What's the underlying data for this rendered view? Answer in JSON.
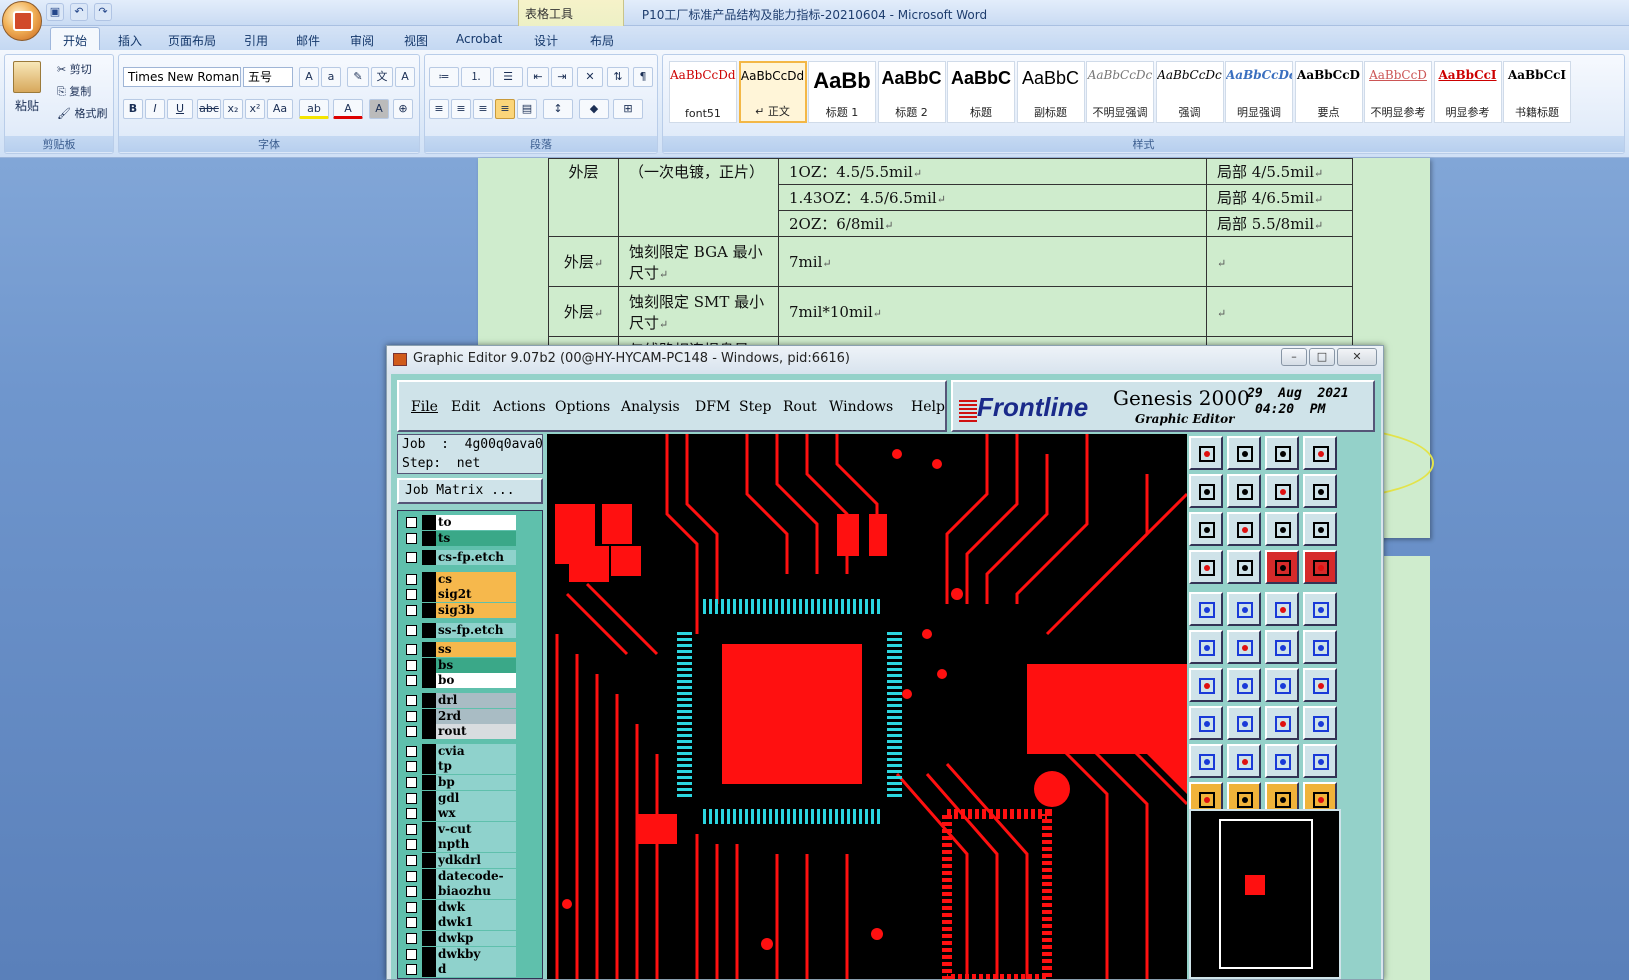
{
  "word": {
    "quick_access": [
      "save",
      "undo",
      "redo"
    ],
    "window_title": "P10工厂标准产品结构及能力指标-20210604 - Microsoft Word",
    "context_tab_group": "表格工具",
    "tabs": [
      "开始",
      "插入",
      "页面布局",
      "引用",
      "邮件",
      "审阅",
      "视图",
      "Acrobat",
      "设计",
      "布局"
    ],
    "active_tab": "开始",
    "clipboard": {
      "paste": "粘贴",
      "cut": "剪切",
      "copy": "复制",
      "format_painter": "格式刷",
      "label": "剪贴板"
    },
    "font": {
      "family": "Times New Roman",
      "size": "五号",
      "label": "字体"
    },
    "paragraph": {
      "label": "段落"
    },
    "styles": {
      "label": "样式",
      "items": [
        {
          "preview": "AaBbCcDdI",
          "name": "font51"
        },
        {
          "preview": "AaBbCcDd",
          "name": "↵ 正文"
        },
        {
          "preview": "AaBb",
          "name": "标题 1"
        },
        {
          "preview": "AaBbC",
          "name": "标题 2"
        },
        {
          "preview": "AaBbC",
          "name": "标题"
        },
        {
          "preview": "AaBbC",
          "name": "副标题"
        },
        {
          "preview": "AaBbCcDc",
          "name": "不明显强调"
        },
        {
          "preview": "AaBbCcDc",
          "name": "强调"
        },
        {
          "preview": "AaBbCcDc",
          "name": "明显强调"
        },
        {
          "preview": "AaBbCcD",
          "name": "要点"
        },
        {
          "preview": "AaBbCcD",
          "name": "不明显参考"
        },
        {
          "preview": "AaBbCcI",
          "name": "明显参考"
        },
        {
          "preview": "AaBbCcI",
          "name": "书籍标题"
        }
      ]
    }
  },
  "document": {
    "rows": [
      {
        "c1": "外层",
        "c2": "（一次电镀，正片）",
        "c3": "1OZ：4.5/5.5mil",
        "c4": "局部 4/5.5mil"
      },
      {
        "c1": "",
        "c2": "",
        "c3": "1.43OZ：4.5/6.5mil",
        "c4": "局部 4/6.5mil"
      },
      {
        "c1": "",
        "c2": "",
        "c3": "2OZ：6/8mil",
        "c4": "局部 5.5/8mil"
      },
      {
        "c1": "外层",
        "c2": "蚀刻限定 BGA 最小尺寸",
        "c3": "7mil",
        "c4": ""
      },
      {
        "c1": "外层",
        "c2": "蚀刻限定 SMT 最小尺寸",
        "c3": "7mil*10mil",
        "c4": ""
      },
      {
        "c1": "",
        "c2": "与线路相连焊盘最",
        "c3": "",
        "c4": ""
      }
    ],
    "para_mark": "↵"
  },
  "genesis": {
    "window_title": "Graphic Editor 9.07b2 (00@HY-HYCAM-PC148 - Windows, pid:6616)",
    "menu": [
      "File",
      "Edit",
      "Actions",
      "Options",
      "Analysis",
      "DFM",
      "Step",
      "Rout",
      "Windows",
      "Help"
    ],
    "brand": "Frontline",
    "product": "Genesis 2000",
    "product_sub": "Graphic Editor",
    "date": "29  Aug  2021",
    "time": "04:20  PM",
    "job": "Job  :  4g00q0ava0",
    "step": "Step:  net",
    "job_matrix": "Job Matrix ...",
    "layers": [
      {
        "name": "to",
        "color": "#ffffff"
      },
      {
        "name": "ts",
        "color": "#3aa888"
      },
      {
        "name": "cs-fp.etch",
        "color": "#8fd2cc"
      },
      {
        "name": "cs",
        "color": "#f6b84c"
      },
      {
        "name": "sig2t",
        "color": "#f6b84c"
      },
      {
        "name": "sig3b",
        "color": "#f6b84c"
      },
      {
        "name": "ss-fp.etch",
        "color": "#8fd2cc"
      },
      {
        "name": "ss",
        "color": "#f6b84c"
      },
      {
        "name": "bs",
        "color": "#3aa888"
      },
      {
        "name": "bo",
        "color": "#ffffff"
      },
      {
        "name": "drl",
        "color": "#a9bcc4"
      },
      {
        "name": "2rd",
        "color": "#a9bcc4"
      },
      {
        "name": "rout",
        "color": "#d8dcdf"
      },
      {
        "name": "cvia",
        "color": "#8fd2cc"
      },
      {
        "name": "tp",
        "color": "#8fd2cc"
      },
      {
        "name": "bp",
        "color": "#8fd2cc"
      },
      {
        "name": "gdl",
        "color": "#8fd2cc"
      },
      {
        "name": "wx",
        "color": "#8fd2cc"
      },
      {
        "name": "v-cut",
        "color": "#8fd2cc"
      },
      {
        "name": "npth",
        "color": "#8fd2cc"
      },
      {
        "name": "ydkdrl",
        "color": "#8fd2cc"
      },
      {
        "name": "datecode-to",
        "color": "#8fd2cc"
      },
      {
        "name": "biaozhu",
        "color": "#8fd2cc"
      },
      {
        "name": "dwk",
        "color": "#8fd2cc"
      },
      {
        "name": "dwk1",
        "color": "#8fd2cc"
      },
      {
        "name": "dwkp",
        "color": "#8fd2cc"
      },
      {
        "name": "dwkby",
        "color": "#8fd2cc"
      },
      {
        "name": "d",
        "color": "#8fd2cc"
      }
    ],
    "colors": {
      "trace": "#ff1010",
      "pad_cyan": "#2bd6e0",
      "panel": "#94d1c9"
    }
  }
}
